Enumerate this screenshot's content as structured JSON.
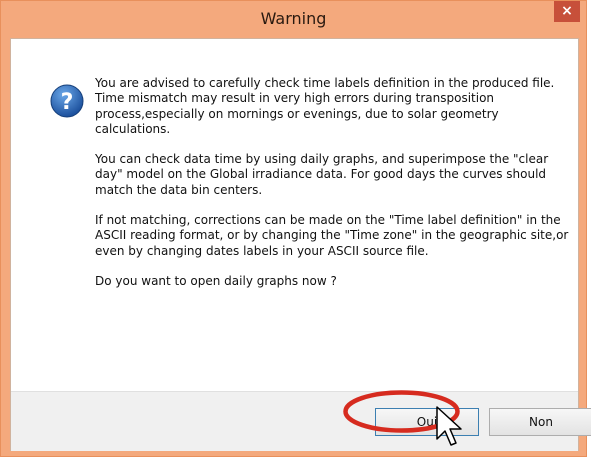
{
  "dialog": {
    "title": "Warning",
    "close_glyph": "×",
    "icon": "question-icon",
    "paragraphs": [
      "You are advised to carefully check time labels definition in the produced file.\nTime mismatch may result in very high errors during transposition process,especially on mornings or evenings, due to solar geometry calculations.",
      "You can check data time by using daily graphs, and superimpose the \"clear day\" model on the Global irradiance data. For good days the curves should match the data bin centers.",
      "If not matching, corrections can be made on the \"Time label definition\" in the ASCII reading format, or by changing the \"Time zone\" in the geographic site,or even by changing dates labels in your ASCII source file.",
      "Do you want to open daily graphs now ?"
    ],
    "buttons": {
      "yes_label": "Oui",
      "no_label": "Non"
    }
  },
  "colors": {
    "titlebar": "#f4a97d",
    "close_button": "#c7503a",
    "annotation": "#d62b1f"
  }
}
